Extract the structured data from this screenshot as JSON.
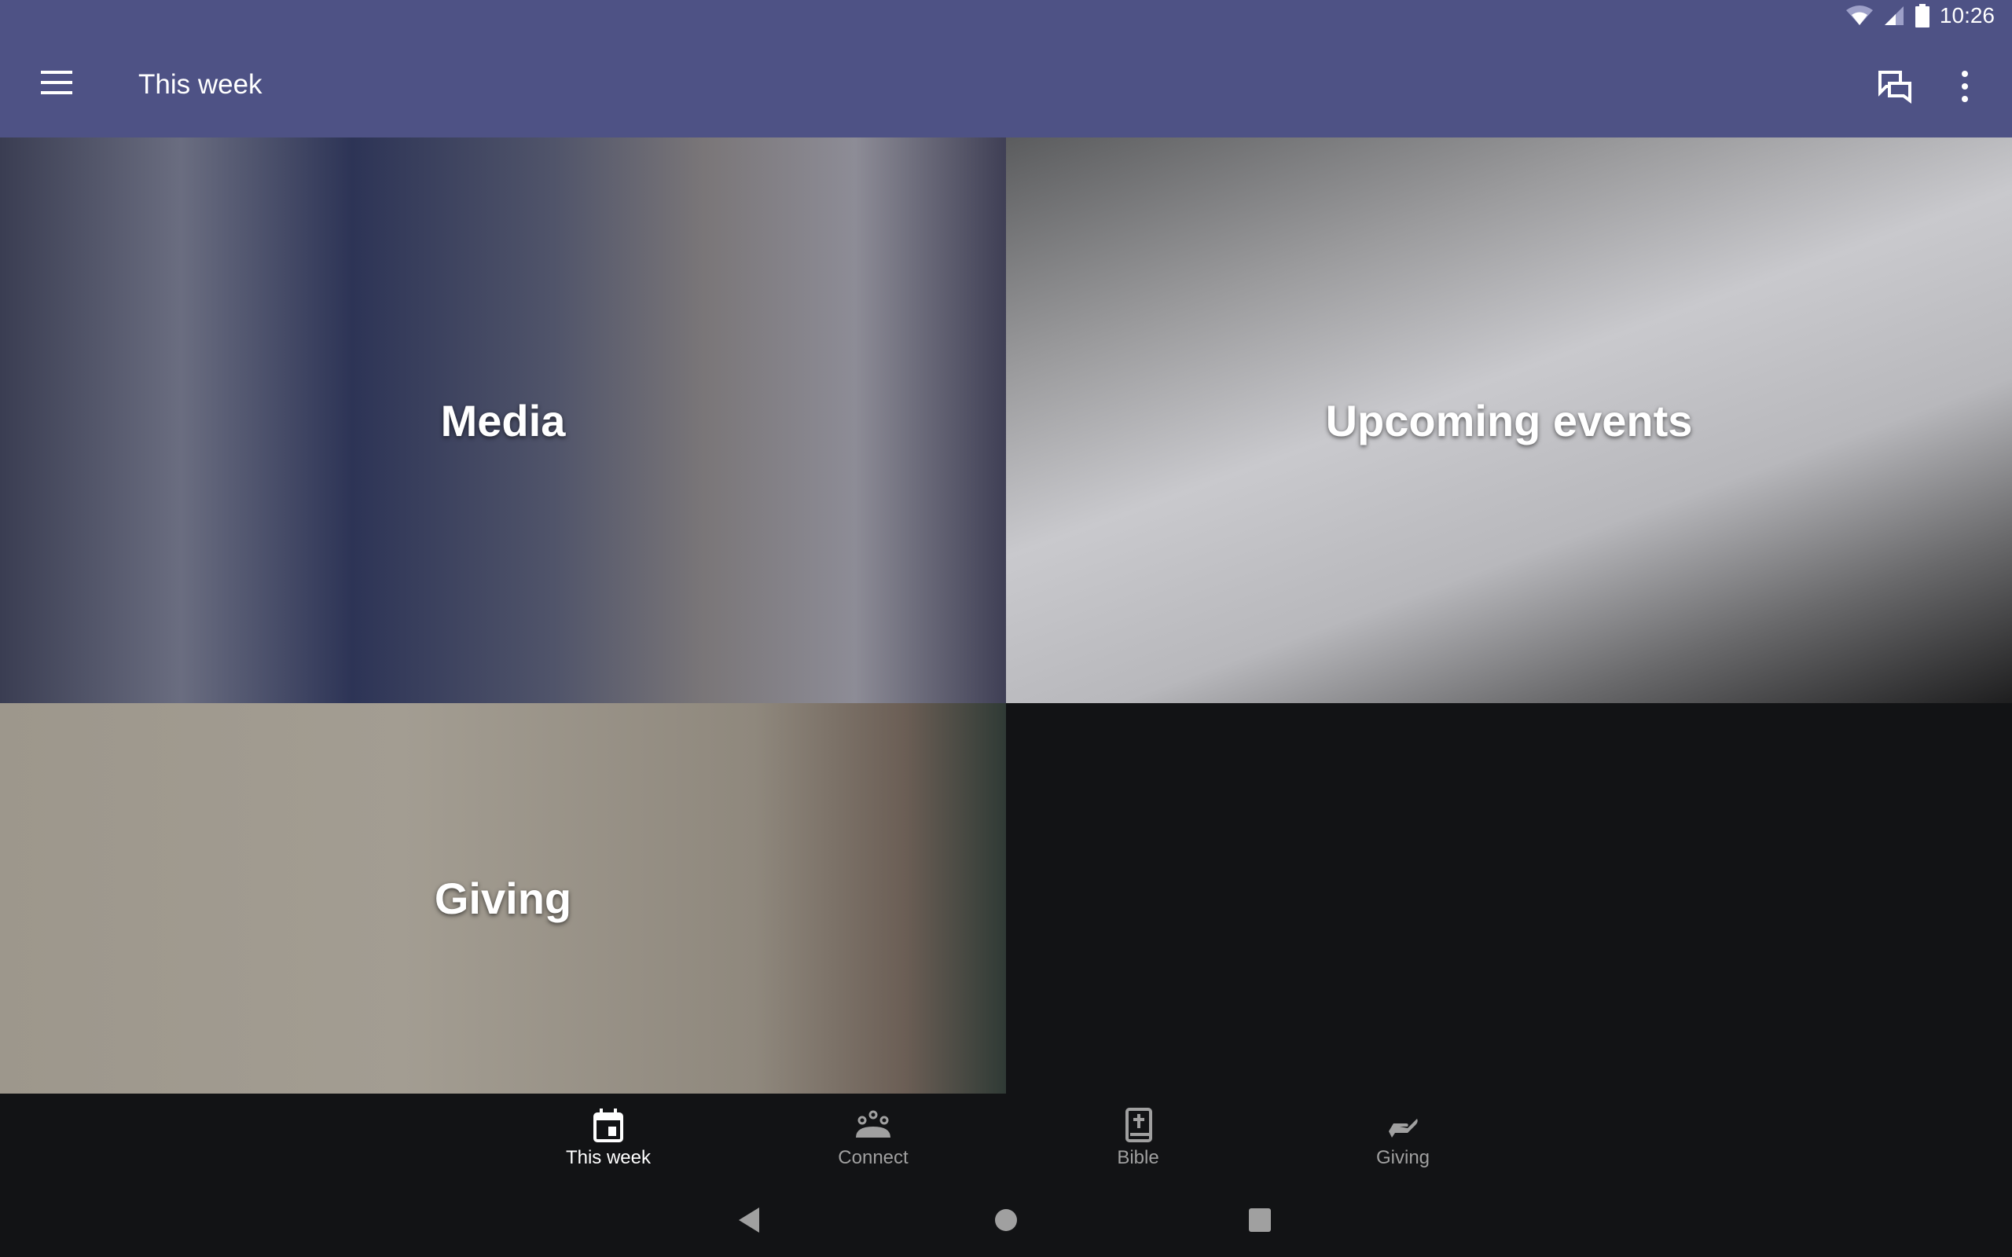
{
  "status_bar": {
    "time": "10:26",
    "icons": [
      "wifi-icon",
      "signal-icon",
      "battery-icon"
    ]
  },
  "app_bar": {
    "title": "This week",
    "icons": [
      "menu-icon",
      "chat-icon",
      "more-vert-icon"
    ]
  },
  "tiles": [
    {
      "label": "Media"
    },
    {
      "label": "Upcoming events"
    },
    {
      "label": "Giving"
    }
  ],
  "bottom_nav": {
    "items": [
      {
        "label": "This week",
        "icon": "calendar-icon",
        "active": true
      },
      {
        "label": "Connect",
        "icon": "people-icon",
        "active": false
      },
      {
        "label": "Bible",
        "icon": "bible-icon",
        "active": false
      },
      {
        "label": "Giving",
        "icon": "giving-hand-icon",
        "active": false
      }
    ]
  },
  "colors": {
    "app_bar": "#4e5285",
    "background": "#121315",
    "inactive": "#a0a0a0"
  }
}
